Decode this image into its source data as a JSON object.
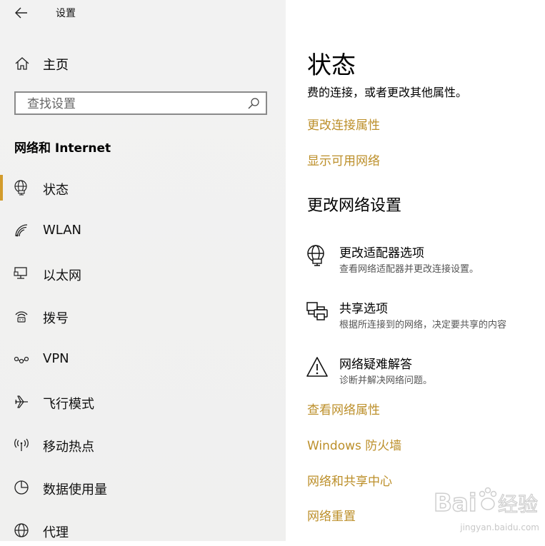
{
  "app": {
    "title": "设置"
  },
  "sidebar": {
    "home_label": "主页",
    "search": {
      "placeholder": "查找设置",
      "value": ""
    },
    "section_title": "网络和 Internet",
    "items": [
      {
        "label": "状态",
        "icon": "globe-monitor-icon",
        "active": true
      },
      {
        "label": "WLAN",
        "icon": "wifi-icon",
        "active": false
      },
      {
        "label": "以太网",
        "icon": "ethernet-icon",
        "active": false
      },
      {
        "label": "拨号",
        "icon": "dialup-icon",
        "active": false
      },
      {
        "label": "VPN",
        "icon": "vpn-icon",
        "active": false
      },
      {
        "label": "飞行模式",
        "icon": "airplane-icon",
        "active": false
      },
      {
        "label": "移动热点",
        "icon": "hotspot-icon",
        "active": false
      },
      {
        "label": "数据使用量",
        "icon": "data-usage-icon",
        "active": false
      },
      {
        "label": "代理",
        "icon": "proxy-globe-icon",
        "active": false
      }
    ]
  },
  "main": {
    "title": "状态",
    "truncated_description": "费的连接，或者更改其他属性。",
    "links_top": [
      "更改连接属性",
      "显示可用网络"
    ],
    "subheading": "更改网络设置",
    "actions": [
      {
        "title": "更改适配器选项",
        "description": "查看网络适配器并更改连接设置。",
        "icon": "adapter-globe-icon"
      },
      {
        "title": "共享选项",
        "description": "根据所连接到的网络，决定要共享的内容",
        "icon": "sharing-printer-icon"
      },
      {
        "title": "网络疑难解答",
        "description": "诊断并解决网络问题。",
        "icon": "warning-icon"
      }
    ],
    "links_bottom": [
      "查看网络属性",
      "Windows 防火墙",
      "网络和共享中心",
      "网络重置"
    ]
  },
  "watermark": {
    "text": "jingyan.baidu.com"
  },
  "colors": {
    "accent": "#d39c2c",
    "link": "#bc8f2a"
  }
}
